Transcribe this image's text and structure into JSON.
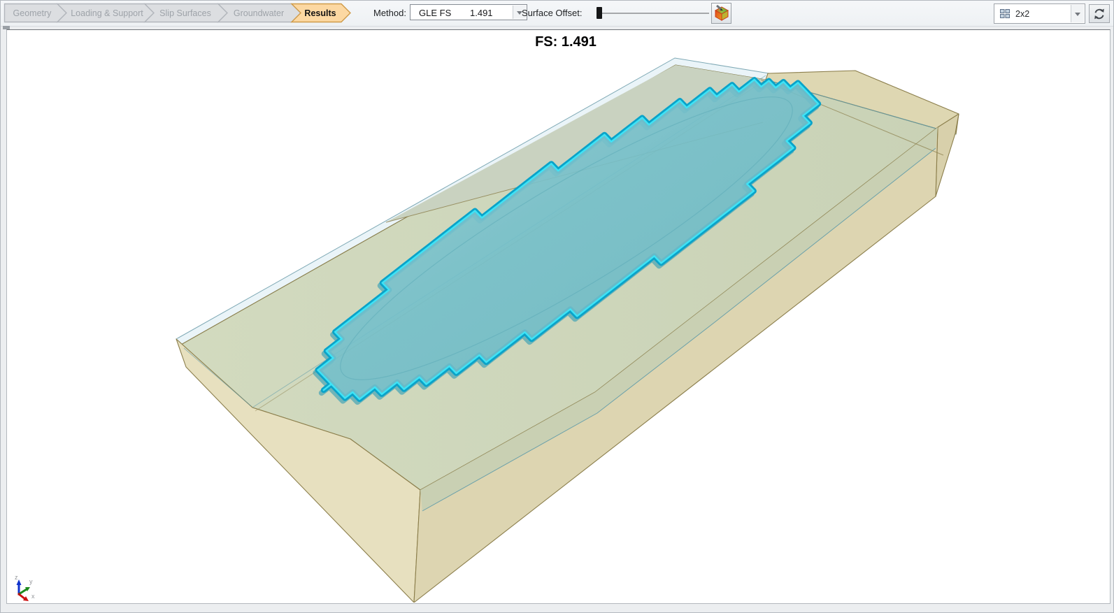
{
  "workflow": {
    "active_tab": "Results",
    "tabs": [
      {
        "label": "Geometry",
        "active": false
      },
      {
        "label": "Loading & Support",
        "active": false
      },
      {
        "label": "Slip Surfaces",
        "active": false
      },
      {
        "label": "Groundwater",
        "active": false
      },
      {
        "label": "Results",
        "active": true
      }
    ]
  },
  "toolbar": {
    "method_label": "Method:",
    "method_value": "GLE FS",
    "method_fs": "1.491",
    "surface_offset_label": "Surface Offset:",
    "view_layout_value": "2x2"
  },
  "viewport": {
    "fs_label": "FS: 1.491"
  },
  "axis": {
    "x": "x",
    "y": "y",
    "z": "z"
  },
  "colors": {
    "accent_cyan_bright": "#3ee3f6",
    "accent_cyan_dark": "#0aa3c9",
    "accent_cyan_shadow": "#0d8fb4",
    "slip_fill_light": "#93ced6",
    "slip_fill": "#74bfca",
    "slip_fill_deep": "#69b6c2",
    "face_green": "#cdd5ba",
    "band_green": "#c9d2c0",
    "crest_tan": "#ded7b2",
    "side_tan_light": "#e7e0bf",
    "side_tan": "#ddd5b1",
    "side_tan_dark": "#d8d0ab",
    "front_band_green": "#c6cfb3",
    "pale_strip": "#eaf4f8",
    "edge_olive": "#8b7e4b",
    "edge_teal": "#5e9aa9",
    "axis_x_red": "#cc1111",
    "axis_y_green": "#1d8a1d",
    "axis_z_blue": "#1133cc"
  }
}
